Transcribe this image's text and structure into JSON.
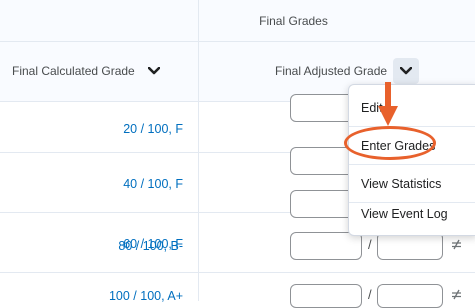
{
  "table": {
    "section_title": "Final Grades",
    "columns": {
      "calculated": "Final Calculated Grade",
      "adjusted": "Final Adjusted Grade"
    },
    "rows": [
      {
        "calculated": "20 / 100, F"
      },
      {
        "calculated": "40 / 100, F"
      },
      {
        "calculated": "60 / 100, F"
      },
      {
        "calculated": "80 / 100, B-"
      },
      {
        "calculated": "100 / 100, A+"
      }
    ],
    "separator": "/"
  },
  "menu": {
    "items": [
      "Edit",
      "Enter Grades",
      "View Statistics",
      "View Event Log"
    ]
  },
  "colors": {
    "link": "#006fbf",
    "annotation": "#e8612c"
  },
  "icons": {
    "column_menu": "chevron-down-icon",
    "no_change": "not-equal-icon"
  }
}
